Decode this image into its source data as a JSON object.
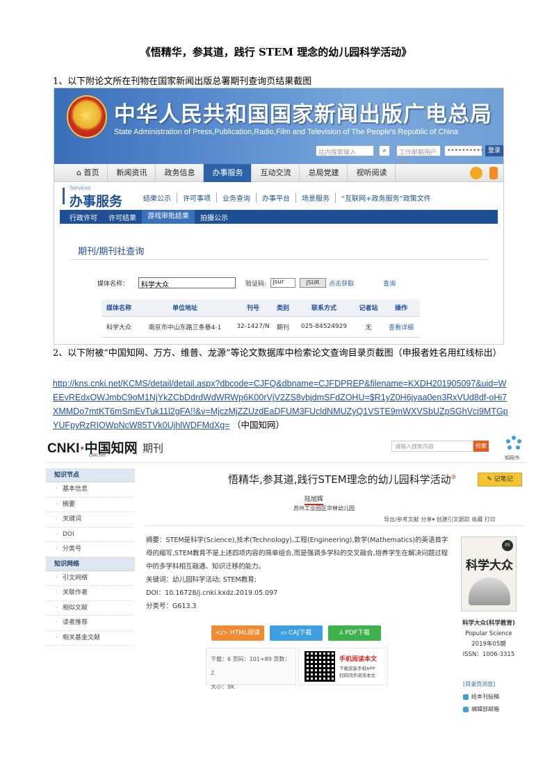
{
  "doc": {
    "title": "《悟精华，参其道，践行 STEM 理念的幼儿园科学活动》",
    "para1": "1、以下附论文所在刊物在国家新闻出版总署期刊查询页结果截图",
    "para2": "2、以下附被“中国知网、万方、维普、龙源”等论文数据库中检索论文查询目录页截图（申报者姓名用红线标出）",
    "link": "http://kns.cnki.net/KCMS/detail/detail.aspx?dbcode=CJFQ&dbname=CJFDPREP&filename=KXDH201905097&uid=WEEvREdxOWJmbC9oM1NjYkZCbDdrdWdWRWp6K00rVjV2ZS8vbjdmSFdZOHU=$R1yZ0H6jyaa0en3RxVUd8df-oHi7XMMDo7mtKT6mSmEvTuk11l2gFA!!&v=MjczMjZZUzdEaDFUM3FUcldNMUZyQ1VSTE9mWXVSbUZpSGhVci9MTGpYUFpyRzRIOWpNcW85TVk0UjhlWDFMdXg=",
    "link_suffix": "（中国知网）"
  },
  "gapp": {
    "cn_title": "中华人民共和国国家新闻出版广电总局",
    "en_title": "State Administration of Press,Publication,Radio,Film and Television of The People's Republic of China",
    "search_placeholder": "站内搜索输入",
    "mail_placeholder": "工作邮箱用户名",
    "pwd_mask": "••••••••••",
    "login": "登录",
    "nav": [
      "⌂ 首页",
      "新闻资讯",
      "政务信息",
      "办事服务",
      "互动交流",
      "总局党建",
      "视听阅读"
    ],
    "services_en": "Services",
    "services_cn": "办事服务",
    "subnav": [
      "结果公示",
      "许可事项",
      "业务查询",
      "办事平台",
      "场景服务",
      "“互联网+政务服务”政策文件"
    ],
    "bluebar": [
      "行政许可",
      "许可结果",
      "游戏审批结果",
      "拍摄公示"
    ],
    "query_title": "期刊/期刊社查询",
    "media_label": "媒体名称：",
    "media_value": "科学大众",
    "code_label": "验证码:",
    "code_value": "jsur",
    "captcha": "JSUR",
    "refresh": "点击获取",
    "query_btn": "查询",
    "table": {
      "headers": [
        "媒体名称",
        "单位地址",
        "刊号",
        "类别",
        "联系方式",
        "记者站",
        "操作"
      ],
      "row": [
        "科学大众",
        "南京市中山东路三条巷4-1",
        "32-1427/N",
        "期刊",
        "025-84524929",
        "无",
        "查看详细"
      ]
    }
  },
  "cnki": {
    "logo": "中国知网",
    "logo_sub": "cnki.net",
    "journal": "期刊",
    "search_placeholder": "请输入搜索内容",
    "search_btn": "检索",
    "flower_label": "知网书",
    "sidebar_sec1": "知识节点",
    "sidebar_items1": [
      "基本信息",
      "摘要",
      "关键词",
      "DOI",
      "分类号"
    ],
    "sidebar_sec2": "知识网络",
    "sidebar_items2": [
      "引文网络",
      "关联作者",
      "相似文献",
      "读者推荐",
      "相关基金文献"
    ],
    "title": "悟精华,参其道,践行STEM理念的幼儿园科学活动",
    "note_btn": "记笔记",
    "author": "陆旭辉",
    "org": "苏州工业园区华林幼儿园",
    "tools": "导出/参考文献  分享▾  创建引文跟踪  收藏  打印",
    "abstract": "摘要：STEM是科学(Science),技术(Technology),工程(Engineering),数学(Mathematics)的英语首字母的缩写,STEM教育不是上述四项内容的简单组合,而是强调多学科的交叉融合,培养学生在解决问题过程中的多学科相互融通、知识迁移的能力。",
    "keywords": "关键词：幼儿园科学活动; STEM教育;",
    "doi": "DOI：10.16728/j.cnki.kxdz.2019.05.097",
    "cls": "分类号：G613.3",
    "btn_html": "HTML阅读",
    "btn_caj": "CAJ下载",
    "btn_pdf": "PDF下载",
    "stats_line1": "下载：6   页码：101+89   页数：2",
    "stats_line2": "大小：9K",
    "mobile_title": "手机阅读本文",
    "mobile_desc1": "下载安装手机APP",
    "mobile_desc2": "扫码同步阅读本文",
    "cover_title": "科学大众",
    "cover_badge": "05",
    "cover_info": [
      "科学大众(科学教育)",
      "Popular Science",
      "2019年05期",
      "ISSN：1006-3315"
    ],
    "toc_title": "[目录页浏览]",
    "toc_links": [
      "给本刊投稿",
      "编辑部邮箱"
    ]
  }
}
